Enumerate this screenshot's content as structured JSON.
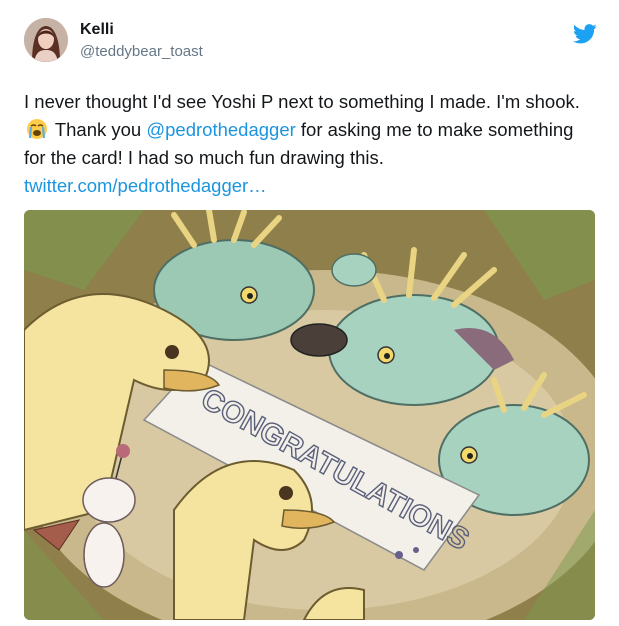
{
  "user": {
    "name": "Kelli",
    "handle": "@teddybear_toast"
  },
  "tweet": {
    "text_1": "I never thought I'd see Yoshi P next to something I made. I'm shook.",
    "emoji": "crying-face",
    "text_2": "Thank you",
    "mention": "@pedrothedagger",
    "text_3": "for asking me to make something for the card! I had so much fun drawing this.",
    "link": "twitter.com/pedrothedagger…"
  },
  "media": {
    "banner_text": "CONGRATULATIONS"
  },
  "colors": {
    "accent": "#1b95e0",
    "twitter_blue": "#1da1f2",
    "secondary_text": "#657786"
  }
}
